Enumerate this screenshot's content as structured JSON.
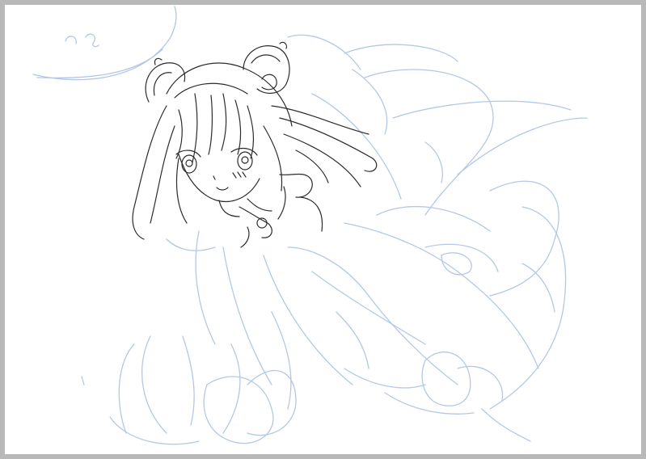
{
  "canvas": {
    "background": "#ffffff",
    "workspace_color": "#b9b9b9"
  },
  "layers": [
    {
      "name": "sketch",
      "color": "#b3c8e6"
    },
    {
      "name": "lineart",
      "color": "#2b2b2b"
    }
  ],
  "icons": {
    "artwork": "anime-girl-lineart-drawing"
  }
}
